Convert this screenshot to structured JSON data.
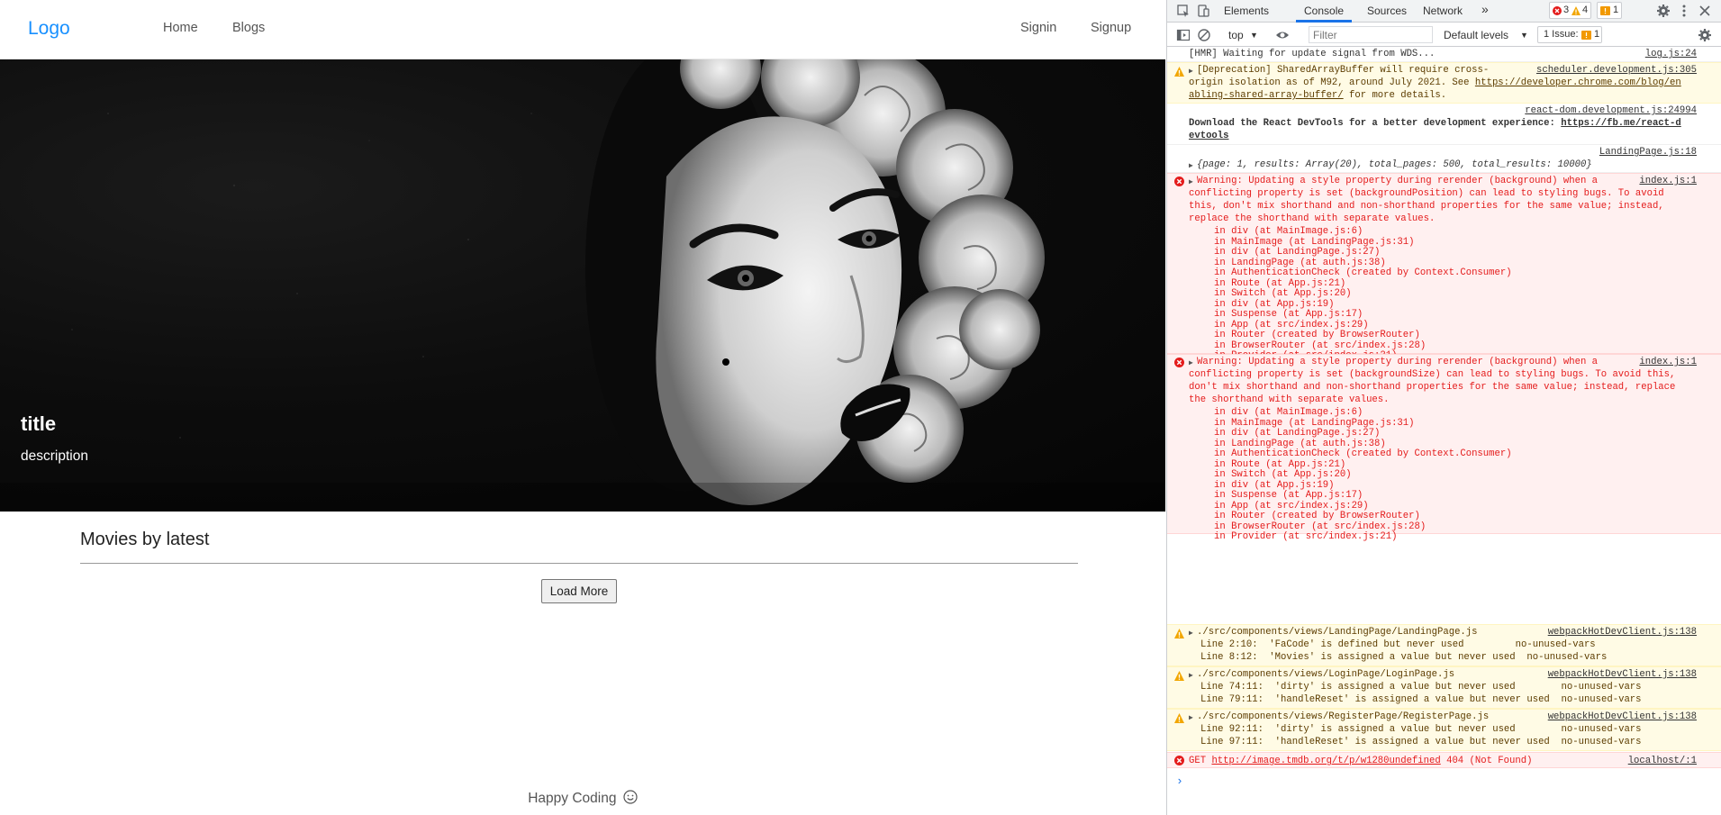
{
  "app": {
    "logo": "Logo",
    "nav_left": [
      "Home",
      "Blogs"
    ],
    "nav_right": [
      "Signin",
      "Signup"
    ],
    "hero": {
      "title": "title",
      "description": "description"
    },
    "section_title": "Movies by latest",
    "load_more_label": "Load More",
    "footer_text": "Happy Coding",
    "brand_color": "#1890ff"
  },
  "devtools": {
    "tabs": [
      "Elements",
      "Console",
      "Sources",
      "Network"
    ],
    "more_tabs": "»",
    "active_tab": "Console",
    "error_count": "3",
    "warning_count": "4",
    "issue_badge_count": "1",
    "context": "top",
    "filter_placeholder": "Filter",
    "levels": "Default levels",
    "issues_label": "1 Issue:",
    "issues_count": "1",
    "console": {
      "m1_text": "[HMR] Waiting for update signal from WDS...",
      "m1_src": "log.js:24",
      "m2_l1": "[Deprecation] SharedArrayBuffer will require cross-",
      "m2_l2a": "origin isolation as of M92, around July 2021. See ",
      "m2_link1": "https://developer.chrome.com/blog/en",
      "m2_link2": "abling-shared-array-buffer/",
      "m2_l3": " for more details.",
      "m2_src": "scheduler.development.js:305",
      "m3_src": "react-dom.development.js:24994",
      "m3_l1a": "Download the React DevTools for a better development experience: ",
      "m3_link1": "https://fb.me/react-d",
      "m3_link2": "evtools",
      "m4_src": "LandingPage.js:18",
      "m4_obj": "{page: 1, results: Array(20), total_pages: 500, total_results: 10000}",
      "e1_src": "index.js:1",
      "e1_lines": [
        "Warning: Updating a style property during rerender (background) when a",
        "conflicting property is set (backgroundPosition) can lead to styling bugs. To avoid",
        "this, don't mix shorthand and non-shorthand properties for the same value; instead,",
        "replace the shorthand with separate values."
      ],
      "e2_src": "index.js:1",
      "e2_lines": [
        "Warning: Updating a style property during rerender (background) when a",
        "conflicting property is set (backgroundSize) can lead to styling bugs. To avoid this,",
        "don't mix shorthand and non-shorthand properties for the same value; instead, replace",
        "the shorthand with separate values."
      ],
      "stack": [
        "in div (at MainImage.js:6)",
        "in MainImage (at LandingPage.js:31)",
        "in div (at LandingPage.js:27)",
        "in LandingPage (at auth.js:38)",
        "in AuthenticationCheck (created by Context.Consumer)",
        "in Route (at App.js:21)",
        "in Switch (at App.js:20)",
        "in div (at App.js:19)",
        "in Suspense (at App.js:17)",
        "in App (at src/index.js:29)",
        "in Router (created by BrowserRouter)",
        "in BrowserRouter (at src/index.js:28)",
        "in Provider (at src/index.js:21)"
      ],
      "w1_path": "./src/components/views/LandingPage/LandingPage.js",
      "w1_src": "webpackHotDevClient.js:138",
      "w1_l1": "Line 2:10:  'FaCode' is defined but never used         no-unused-vars",
      "w1_l2": "Line 8:12:  'Movies' is assigned a value but never used  no-unused-vars",
      "w2_path": "./src/components/views/LoginPage/LoginPage.js",
      "w2_src": "webpackHotDevClient.js:138",
      "w2_l1": "Line 74:11:  'dirty' is assigned a value but never used        no-unused-vars",
      "w2_l2": "Line 79:11:  'handleReset' is assigned a value but never used  no-unused-vars",
      "w3_path": "./src/components/views/RegisterPage/RegisterPage.js",
      "w3_src": "webpackHotDevClient.js:138",
      "w3_l1": "Line 92:11:  'dirty' is assigned a value but never used        no-unused-vars",
      "w3_l2": "Line 97:11:  'handleReset' is assigned a value but never used  no-unused-vars",
      "e3_prefix": "GET ",
      "e3_url": "http://image.tmdb.org/t/p/w1280undefined",
      "e3_status": " 404 (Not Found)",
      "e3_src": "localhost/:1",
      "prompt": "›"
    }
  }
}
